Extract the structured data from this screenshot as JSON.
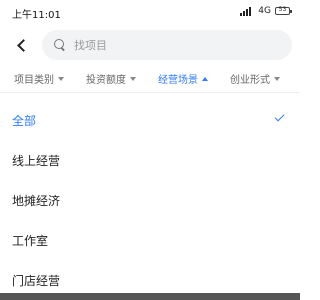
{
  "status_bar": {
    "time": "上午11:01",
    "network": "4G",
    "battery": "53"
  },
  "search": {
    "placeholder": "找项目"
  },
  "filters": [
    {
      "label": "项目类别",
      "active": false
    },
    {
      "label": "投资额度",
      "active": false
    },
    {
      "label": "经营场景",
      "active": true
    },
    {
      "label": "创业形式",
      "active": false
    }
  ],
  "options": [
    {
      "label": "全部",
      "selected": true
    },
    {
      "label": "线上经营",
      "selected": false
    },
    {
      "label": "地摊经济",
      "selected": false
    },
    {
      "label": "工作室",
      "selected": false
    },
    {
      "label": "门店经营",
      "selected": false
    }
  ],
  "colors": {
    "accent": "#2f7bf5",
    "text": "#222222",
    "muted": "#666666",
    "search_bg": "#f2f3f5"
  }
}
